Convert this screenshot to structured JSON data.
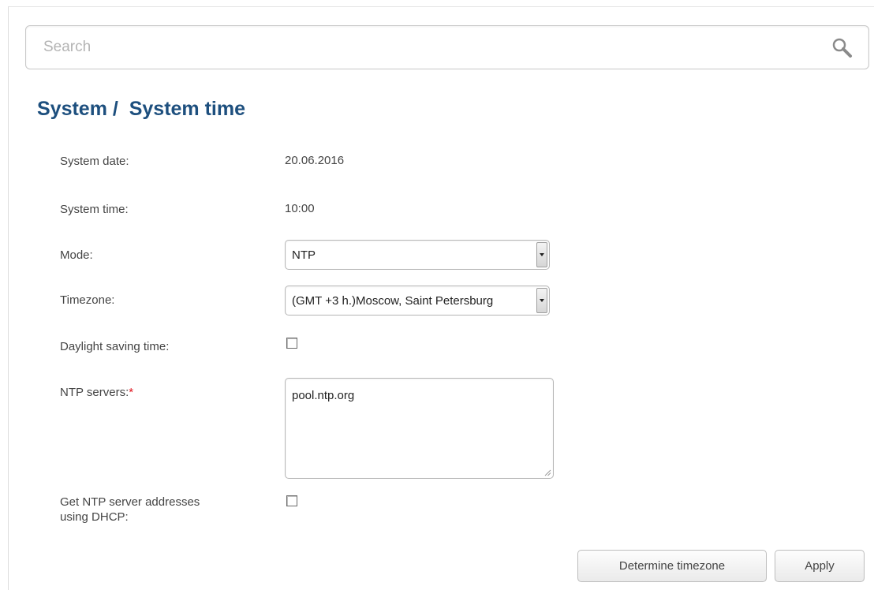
{
  "search": {
    "placeholder": "Search",
    "icon": "search-icon"
  },
  "page": {
    "title": "System /  System time"
  },
  "fields": {
    "system_date": {
      "label": "System date:",
      "value": "20.06.2016"
    },
    "system_time": {
      "label": "System time:",
      "value": "10:00"
    },
    "mode": {
      "label": "Mode:",
      "selected": "NTP"
    },
    "timezone": {
      "label": "Timezone:",
      "selected": "(GMT +3 h.)Moscow, Saint Petersburg"
    },
    "dst": {
      "label": "Daylight saving time:",
      "checked": false
    },
    "ntp_servers": {
      "label": "NTP servers:",
      "required_mark": "*",
      "value": "pool.ntp.org"
    },
    "ntp_dhcp": {
      "label_line1": "Get NTP server addresses",
      "label_line2": "using DHCP:",
      "checked": false
    }
  },
  "buttons": {
    "determine_timezone": "Determine timezone",
    "apply": "Apply"
  },
  "colors": {
    "title": "#1d4f7e",
    "required": "#e0141e"
  }
}
